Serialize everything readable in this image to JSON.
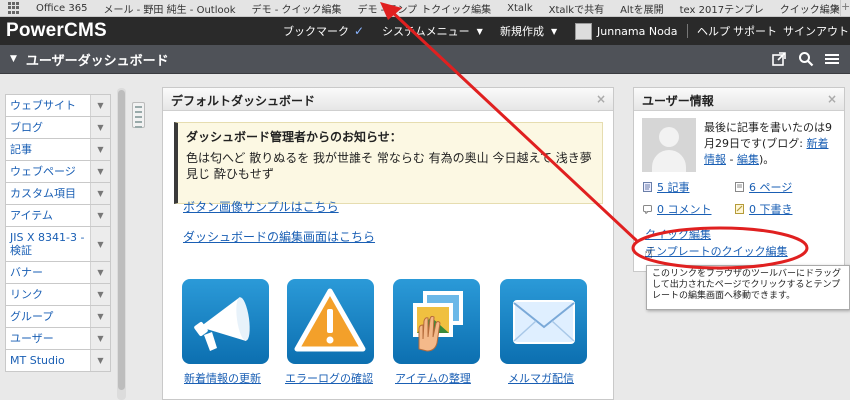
{
  "bookmarks": {
    "items": [
      "Office 365",
      "メール - 野田 純生 - Outlook",
      "デモ - クイック編集",
      "デモ - テンプ",
      "トクイック編集",
      "Xtalk",
      "Xtalkで共有",
      "Altを展開",
      "tex 2017テンプレ",
      "クイック編集"
    ],
    "more": "»",
    "new_tab": "+"
  },
  "header": {
    "logo": "PowerCMS",
    "bookmark": "ブックマーク",
    "system_menu": "システムメニュー",
    "new_create": "新規作成",
    "user_name": "Junnama Noda",
    "help": "ヘルプ",
    "support": "サポート",
    "signout": "サインアウト"
  },
  "titlebar": {
    "title": "ユーザーダッシュボード"
  },
  "sidebar": {
    "items": [
      {
        "label": "ウェブサイト"
      },
      {
        "label": "ブログ"
      },
      {
        "label": "記事"
      },
      {
        "label": "ウェブページ"
      },
      {
        "label": "カスタム項目"
      },
      {
        "label": "アイテム"
      },
      {
        "label": "JIS X 8341-3 - 検証"
      },
      {
        "label": "バナー"
      },
      {
        "label": "リンク"
      },
      {
        "label": "グループ"
      },
      {
        "label": "ユーザー"
      },
      {
        "label": "MT Studio"
      }
    ]
  },
  "dashboard": {
    "title": "デフォルトダッシュボード",
    "close": "×",
    "notice_title": "ダッシュボード管理者からのお知らせ：",
    "notice_body": "色は匂へど 散りぬるを 我が世誰そ 常ならむ 有為の奥山 今日越えて 浅き夢見じ 酔ひもせず",
    "link1": "ボタン画像サンプルはこちら",
    "link2": "ダッシュボードの編集画面はこちら",
    "tiles": [
      {
        "label": "新着情報の更新",
        "icon": "megaphone-icon"
      },
      {
        "label": "エラーログの確認",
        "icon": "warning-icon"
      },
      {
        "label": "アイテムの整理",
        "icon": "photos-icon"
      },
      {
        "label": "メルマガ配信",
        "icon": "mail-icon"
      }
    ]
  },
  "user_info": {
    "title": "ユーザー情報",
    "close": "×",
    "last_post_prefix": "最後に記事を書いたのは9月29日です(ブログ: ",
    "last_post_link1": "新着情報",
    "last_post_sep": " - ",
    "last_post_link2": "編集",
    "last_post_suffix": ")。",
    "entries": "5 記事",
    "pages": "6 ページ",
    "comments": "0 コメント",
    "drafts": "0 下書き",
    "quick_edit": "クイック編集",
    "template_quick_edit": "テンプレートのクイック編集",
    "tooltip": "このリンクをブラウザのツールバーにドラッグして出力されたページでクリックするとテンプレートの編集画面へ移動できます。"
  },
  "colors": {
    "annotation": "#e02020",
    "link": "#1a5fb4",
    "header_bg": "#2a2a2a",
    "titlebar_bg": "#4f5258"
  }
}
